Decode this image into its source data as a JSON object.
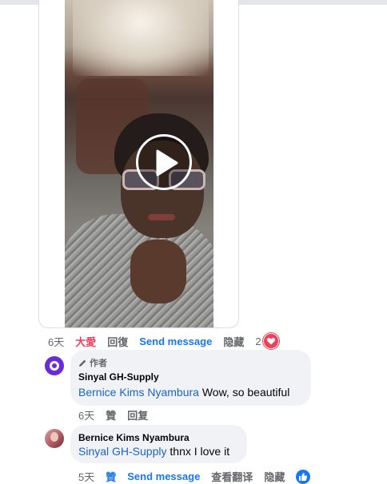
{
  "video": {
    "play_icon": "play-icon"
  },
  "post_actions": {
    "time": "6天",
    "reaction": "大愛",
    "reply": "回復",
    "send_message": "Send message",
    "hide": "隐藏",
    "reaction_count": "2",
    "reaction_icon": "heart-icon"
  },
  "comments": [
    {
      "author_badge": "作者",
      "name": "Sinyal GH-Supply",
      "mention": "Bernice Kims Nyambura",
      "text": " Wow, so beautiful",
      "actions": {
        "time": "6天",
        "like": "贊",
        "reply": "回复"
      }
    },
    {
      "name": "Bernice Kims Nyambura",
      "mention": "Sinyal GH-Supply",
      "text": " thnx I love it",
      "actions": {
        "time": "5天",
        "like": "贊",
        "send_message": "Send message",
        "translate": "查看翻译",
        "hide": "隐藏"
      }
    }
  ],
  "colors": {
    "accent": "#1877f2",
    "love": "#f33e58",
    "bubble": "#f0f2f5"
  }
}
